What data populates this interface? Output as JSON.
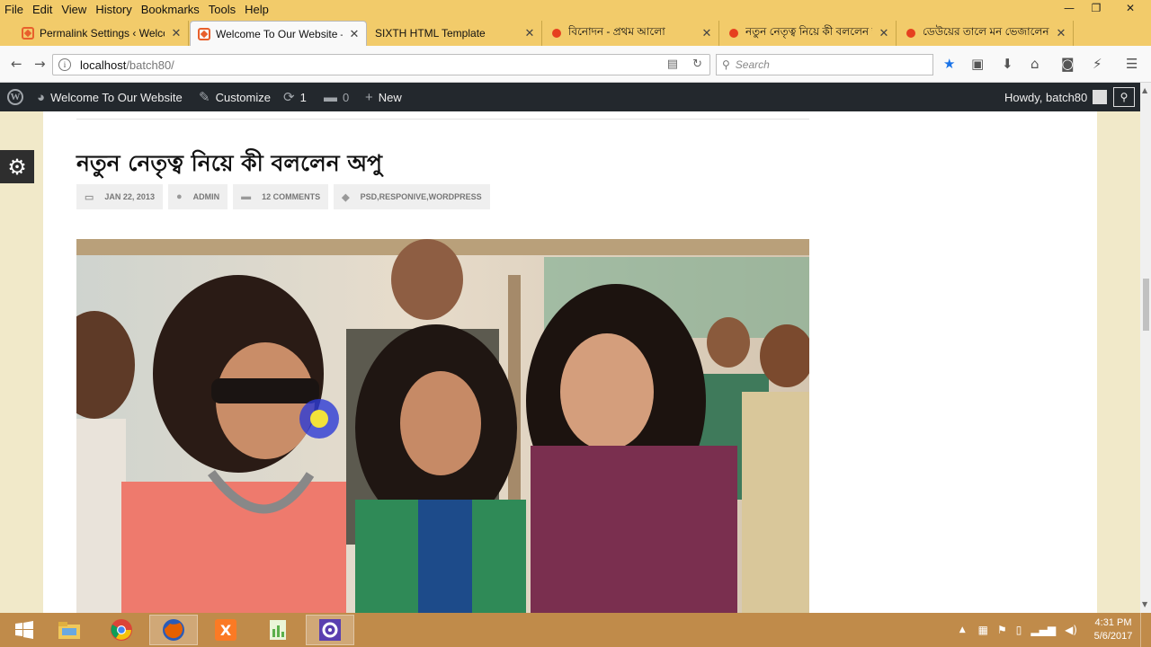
{
  "menubar": {
    "items": [
      "File",
      "Edit",
      "View",
      "History",
      "Bookmarks",
      "Tools",
      "Help"
    ]
  },
  "tabs": [
    {
      "title": "Permalink Settings ‹ Welcom",
      "favicon": "site-icon",
      "active": false
    },
    {
      "title": "Welcome To Our Website –",
      "favicon": "site-icon",
      "active": true
    },
    {
      "title": "SIXTH HTML Template",
      "favicon": "none",
      "active": false
    },
    {
      "title": "বিনোদন - প্রথম আলো",
      "favicon": "red-dot-icon",
      "active": false
    },
    {
      "title": "নতুন নেতৃত্ব নিয়ে কী বললেন অপু",
      "favicon": "red-dot-icon",
      "active": false
    },
    {
      "title": "ডেউয়ের তালে মন ভেজালেন প্রধান",
      "favicon": "red-dot-icon",
      "active": false
    }
  ],
  "navbar": {
    "url_host": "localhost",
    "url_path": "/batch80/",
    "search_placeholder": "Search"
  },
  "adminbar": {
    "site_name": "Welcome To Our Website",
    "customize": "Customize",
    "updates_count": "1",
    "comments_count": "0",
    "new_label": "New",
    "howdy": "Howdy, batch80"
  },
  "post": {
    "title": "নতুন নেতৃত্ব নিয়ে কী বললেন অপু",
    "date": "JAN 22, 2013",
    "author": "ADMIN",
    "comments": "12 COMMENTS",
    "tags": "PSD,RESPONIVE,WORDPRESS"
  },
  "taskbar": {
    "time": "4:31 PM",
    "date": "5/6/2017"
  },
  "colors": {
    "firefox_chrome": "#f2cb6a",
    "wp_adminbar": "#23282d",
    "taskbar": "#c08b4a",
    "page_bg": "#f1e9c9"
  }
}
